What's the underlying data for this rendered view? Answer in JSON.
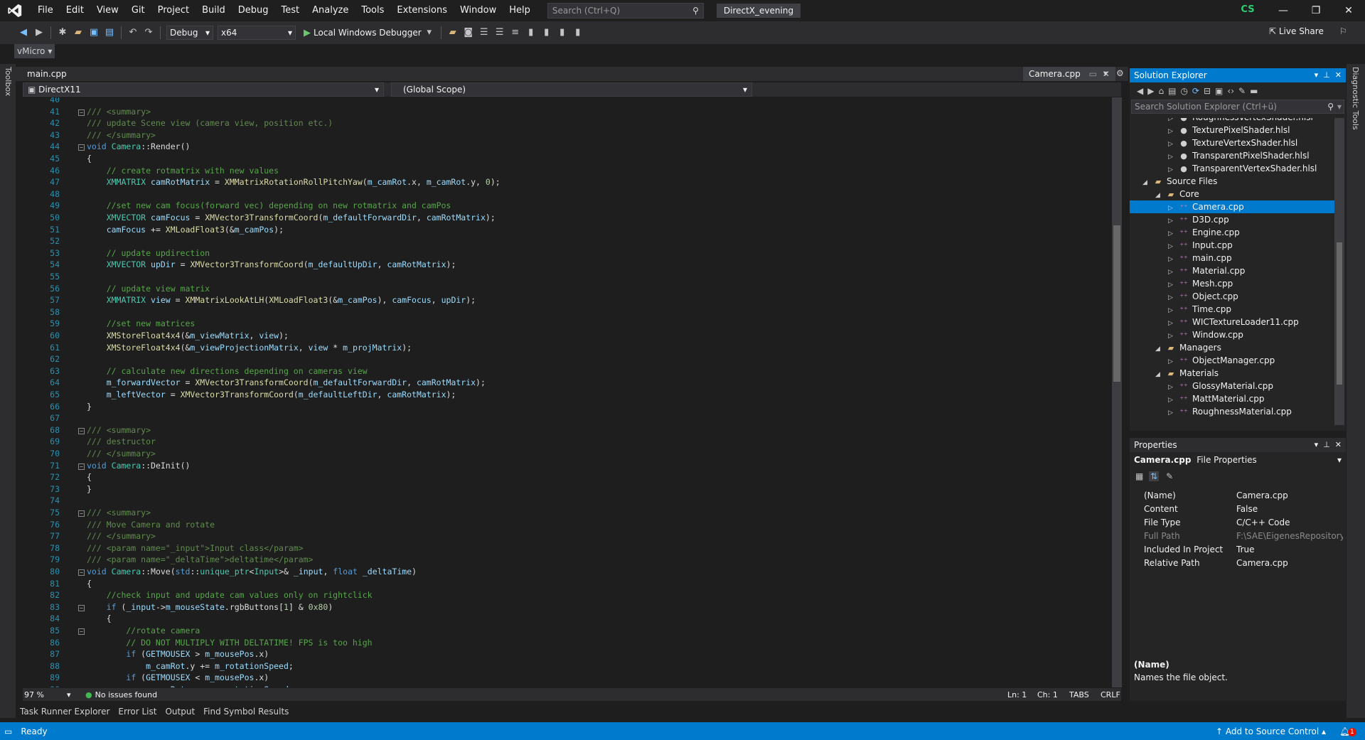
{
  "menu": [
    "File",
    "Edit",
    "View",
    "Git",
    "Project",
    "Build",
    "Debug",
    "Test",
    "Analyze",
    "Tools",
    "Extensions",
    "Window",
    "Help"
  ],
  "search_placeholder": "Search (Ctrl+Q)",
  "solution_name": "DirectX_evening",
  "user_initials": "CS",
  "toolbar": {
    "config": "Debug",
    "platform": "x64",
    "run_label": "Local Windows Debugger",
    "live_share": "Live Share"
  },
  "vmicro": "vMicro",
  "side_labels": {
    "toolbox": "Toolbox",
    "diagnostic": "Diagnostic Tools"
  },
  "tabs": {
    "main": "main.cpp",
    "preview": "Camera.cpp"
  },
  "nav": {
    "project": "DirectX11",
    "scope": "(Global Scope)"
  },
  "code_lines": [
    {
      "n": "40",
      "t": ""
    },
    {
      "n": "41",
      "t": "/// <summary>",
      "c": "xml",
      "f": "⊟"
    },
    {
      "n": "42",
      "t": "/// update Scene view (camera view, position etc.)",
      "c": "xml"
    },
    {
      "n": "43",
      "t": "/// </summary>",
      "c": "xml"
    },
    {
      "n": "44",
      "t": "void Camera::Render()",
      "c": "fn",
      "f": "⊟"
    },
    {
      "n": "45",
      "t": "{"
    },
    {
      "n": "46",
      "t": "    // create rotmatrix with new values",
      "c": "comment"
    },
    {
      "n": "47",
      "t": "    XMMATRIX camRotMatrix = XMMatrixRotationRollPitchYaw(m_camRot.x, m_camRot.y, 0);"
    },
    {
      "n": "48",
      "t": ""
    },
    {
      "n": "49",
      "t": "    //set new cam focus(forward vec) depending on new rotmatrix and camPos",
      "c": "comment"
    },
    {
      "n": "50",
      "t": "    XMVECTOR camFocus = XMVector3TransformCoord(m_defaultForwardDir, camRotMatrix);"
    },
    {
      "n": "51",
      "t": "    camFocus += XMLoadFloat3(&m_camPos);"
    },
    {
      "n": "52",
      "t": ""
    },
    {
      "n": "53",
      "t": "    // update updirection",
      "c": "comment"
    },
    {
      "n": "54",
      "t": "    XMVECTOR upDir = XMVector3TransformCoord(m_defaultUpDir, camRotMatrix);"
    },
    {
      "n": "55",
      "t": ""
    },
    {
      "n": "56",
      "t": "    // update view matrix",
      "c": "comment"
    },
    {
      "n": "57",
      "t": "    XMMATRIX view = XMMatrixLookAtLH(XMLoadFloat3(&m_camPos), camFocus, upDir);"
    },
    {
      "n": "58",
      "t": ""
    },
    {
      "n": "59",
      "t": "    //set new matrices",
      "c": "comment"
    },
    {
      "n": "60",
      "t": "    XMStoreFloat4x4(&m_viewMatrix, view);"
    },
    {
      "n": "61",
      "t": "    XMStoreFloat4x4(&m_viewProjectionMatrix, view * m_projMatrix);"
    },
    {
      "n": "62",
      "t": ""
    },
    {
      "n": "63",
      "t": "    // calculate new directions depending on cameras view",
      "c": "comment"
    },
    {
      "n": "64",
      "t": "    m_forwardVector = XMVector3TransformCoord(m_defaultForwardDir, camRotMatrix);"
    },
    {
      "n": "65",
      "t": "    m_leftVector = XMVector3TransformCoord(m_defaultLeftDir, camRotMatrix);"
    },
    {
      "n": "66",
      "t": "}"
    },
    {
      "n": "67",
      "t": ""
    },
    {
      "n": "68",
      "t": "/// <summary>",
      "c": "xml",
      "f": "⊟"
    },
    {
      "n": "69",
      "t": "/// destructor",
      "c": "xml"
    },
    {
      "n": "70",
      "t": "/// </summary>",
      "c": "xml"
    },
    {
      "n": "71",
      "t": "void Camera::DeInit()",
      "c": "fn",
      "f": "⊟"
    },
    {
      "n": "72",
      "t": "{"
    },
    {
      "n": "73",
      "t": "}"
    },
    {
      "n": "74",
      "t": ""
    },
    {
      "n": "75",
      "t": "/// <summary>",
      "c": "xml",
      "f": "⊟"
    },
    {
      "n": "76",
      "t": "/// Move Camera and rotate",
      "c": "xml"
    },
    {
      "n": "77",
      "t": "/// </summary>",
      "c": "xml"
    },
    {
      "n": "78",
      "t": "/// <param name=\"_input\">Input class</param>",
      "c": "xml"
    },
    {
      "n": "79",
      "t": "/// <param name=\"_deltaTime\">deltatime</param>",
      "c": "xml"
    },
    {
      "n": "80",
      "t": "void Camera::Move(std::unique_ptr<Input>& _input, float _deltaTime)",
      "c": "fn",
      "f": "⊟"
    },
    {
      "n": "81",
      "t": "{"
    },
    {
      "n": "82",
      "t": "    //check input and update cam values only on rightclick",
      "c": "comment"
    },
    {
      "n": "83",
      "t": "    if (_input->m_mouseState.rgbButtons[1] & 0x80)",
      "f": "⊟"
    },
    {
      "n": "84",
      "t": "    {"
    },
    {
      "n": "85",
      "t": "        //rotate camera",
      "c": "comment",
      "f": "⊟"
    },
    {
      "n": "86",
      "t": "        // DO NOT MULTIPLY WITH DELTATIME! FPS is too high",
      "c": "comment"
    },
    {
      "n": "87",
      "t": "        if (GETMOUSEX > m_mousePos.x)"
    },
    {
      "n": "88",
      "t": "            m_camRot.y += m_rotationSpeed;"
    },
    {
      "n": "89",
      "t": "        if (GETMOUSEX < m_mousePos.x)"
    },
    {
      "n": "90",
      "t": "            m_camRot.y -= m_rotationSpeed;"
    }
  ],
  "status_line": {
    "zoom": "97 %",
    "issues": "No issues found",
    "ln": "Ln: 1",
    "ch": "Ch: 1",
    "tabs": "TABS",
    "crlf": "CRLF"
  },
  "bottom_tabs": [
    "Task Runner Explorer",
    "Error List",
    "Output",
    "Find Symbol Results"
  ],
  "statusbar": {
    "ready": "Ready",
    "source_control": "Add to Source Control",
    "notif": "1"
  },
  "solution_explorer": {
    "title": "Solution Explorer",
    "search_placeholder": "Search Solution Explorer (Ctrl+ü)",
    "items": [
      {
        "label": "RoughnessVertexShader.hlsl",
        "indent": 4,
        "icon": "shader-icon",
        "arrow": "▷"
      },
      {
        "label": "TexturePixelShader.hlsl",
        "indent": 4,
        "icon": "shader-icon",
        "arrow": "▷"
      },
      {
        "label": "TextureVertexShader.hlsl",
        "indent": 4,
        "icon": "shader-icon",
        "arrow": "▷"
      },
      {
        "label": "TransparentPixelShader.hlsl",
        "indent": 4,
        "icon": "shader-icon",
        "arrow": "▷"
      },
      {
        "label": "TransparentVertexShader.hlsl",
        "indent": 4,
        "icon": "shader-icon",
        "arrow": "▷"
      },
      {
        "label": "Source Files",
        "indent": 2,
        "icon": "folder-icon",
        "arrow": "◢"
      },
      {
        "label": "Core",
        "indent": 3,
        "icon": "folder-icon",
        "arrow": "◢"
      },
      {
        "label": "Camera.cpp",
        "indent": 4,
        "icon": "cpp-icon",
        "arrow": "▷",
        "selected": true
      },
      {
        "label": "D3D.cpp",
        "indent": 4,
        "icon": "cpp-icon",
        "arrow": "▷"
      },
      {
        "label": "Engine.cpp",
        "indent": 4,
        "icon": "cpp-icon",
        "arrow": "▷"
      },
      {
        "label": "Input.cpp",
        "indent": 4,
        "icon": "cpp-icon",
        "arrow": "▷"
      },
      {
        "label": "main.cpp",
        "indent": 4,
        "icon": "cpp-icon",
        "arrow": "▷"
      },
      {
        "label": "Material.cpp",
        "indent": 4,
        "icon": "cpp-icon",
        "arrow": "▷"
      },
      {
        "label": "Mesh.cpp",
        "indent": 4,
        "icon": "cpp-icon",
        "arrow": "▷"
      },
      {
        "label": "Object.cpp",
        "indent": 4,
        "icon": "cpp-icon",
        "arrow": "▷"
      },
      {
        "label": "Time.cpp",
        "indent": 4,
        "icon": "cpp-icon",
        "arrow": "▷"
      },
      {
        "label": "WICTextureLoader11.cpp",
        "indent": 4,
        "icon": "cpp-icon",
        "arrow": "▷"
      },
      {
        "label": "Window.cpp",
        "indent": 4,
        "icon": "cpp-icon",
        "arrow": "▷"
      },
      {
        "label": "Managers",
        "indent": 3,
        "icon": "folder-icon",
        "arrow": "◢"
      },
      {
        "label": "ObjectManager.cpp",
        "indent": 4,
        "icon": "cpp-icon",
        "arrow": "▷"
      },
      {
        "label": "Materials",
        "indent": 3,
        "icon": "folder-icon",
        "arrow": "◢"
      },
      {
        "label": "GlossyMaterial.cpp",
        "indent": 4,
        "icon": "cpp-icon",
        "arrow": "▷"
      },
      {
        "label": "MattMaterial.cpp",
        "indent": 4,
        "icon": "cpp-icon",
        "arrow": "▷"
      },
      {
        "label": "RoughnessMaterial.cpp",
        "indent": 4,
        "icon": "cpp-icon",
        "arrow": "▷"
      }
    ]
  },
  "properties": {
    "title": "Properties",
    "object": "Camera.cpp",
    "object_type": "File Properties",
    "rows": [
      {
        "k": "(Name)",
        "v": "Camera.cpp"
      },
      {
        "k": "Content",
        "v": "False"
      },
      {
        "k": "File Type",
        "v": "C/C++ Code"
      },
      {
        "k": "Full Path",
        "v": "F:\\SAE\\EigenesRepository\\D",
        "dim": true
      },
      {
        "k": "Included In Project",
        "v": "True"
      },
      {
        "k": "Relative Path",
        "v": "Camera.cpp"
      }
    ],
    "desc_title": "(Name)",
    "desc_text": "Names the file object."
  }
}
